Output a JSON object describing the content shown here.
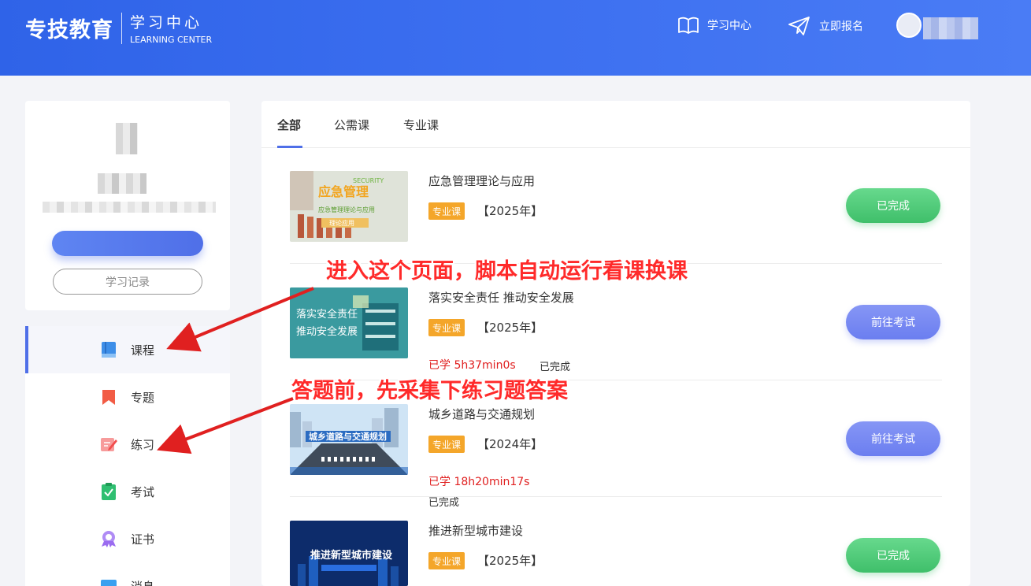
{
  "header": {
    "logo_main": "专技教育",
    "logo_sub_cn": "学习中心",
    "logo_sub_en": "LEARNING CENTER",
    "nav": [
      {
        "label": "学习中心",
        "icon": "book-open-icon"
      },
      {
        "label": "立即报名",
        "icon": "paper-plane-icon"
      }
    ]
  },
  "profile": {
    "record_button": "学习记录"
  },
  "menu": [
    {
      "label": "课程",
      "icon": "course-book-icon",
      "color": "#3d8ee8",
      "active": true
    },
    {
      "label": "专题",
      "icon": "bookmark-icon",
      "color": "#f25c45",
      "active": false
    },
    {
      "label": "练习",
      "icon": "practice-edit-icon",
      "color": "#f26b6b",
      "active": false
    },
    {
      "label": "考试",
      "icon": "exam-clipboard-icon",
      "color": "#2fbf71",
      "active": false
    },
    {
      "label": "证书",
      "icon": "certificate-badge-icon",
      "color": "#9b6cf0",
      "active": false
    },
    {
      "label": "消息",
      "icon": "message-icon",
      "color": "#3aa0f0",
      "active": false
    }
  ],
  "tabs": [
    {
      "label": "全部",
      "active": true
    },
    {
      "label": "公需课",
      "active": false
    },
    {
      "label": "专业课",
      "active": false
    }
  ],
  "courses": [
    {
      "title": "应急管理理论与应用",
      "tag": "专业课",
      "year": "【2025年】",
      "study": "",
      "done_text": "",
      "button": "已完成",
      "button_style": "green",
      "thumb_text": "应急管理",
      "thumb_sub": "应急管理理论与应用",
      "thumb_small": "SECURITY",
      "thumb_box": "理论应用"
    },
    {
      "title": "落实安全责任 推动安全发展",
      "tag": "专业课",
      "year": "【2025年】",
      "study": "已学 5h37min0s",
      "done_text": "已完成",
      "button": "前往考试",
      "button_style": "purple",
      "thumb_text": "落实安全责任",
      "thumb_sub": "推动安全发展"
    },
    {
      "title": "城乡道路与交通规划",
      "tag": "专业课",
      "year": "【2024年】",
      "study": "已学 18h20min17s",
      "done_text": "已完成",
      "button": "前往考试",
      "button_style": "purple",
      "thumb_text": "城乡道路与交通规划"
    },
    {
      "title": "推进新型城市建设",
      "tag": "专业课",
      "year": "【2025年】",
      "study": "",
      "done_text": "",
      "button": "已完成",
      "button_style": "green",
      "thumb_text": "推进新型城市建设"
    }
  ],
  "annotations": [
    "进入这个页面，脚本自动运行看课换课",
    "答题前，先采集下练习题答案"
  ]
}
